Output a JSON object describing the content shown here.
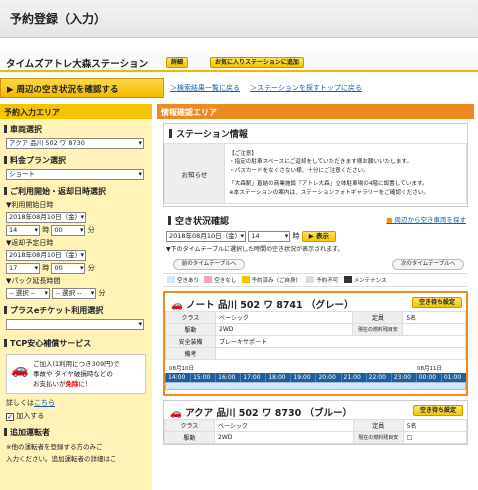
{
  "page_title": "予約登録（入力）",
  "station": {
    "name": "タイムズアトレ大森ステーション",
    "details_btn": "詳細",
    "favorite_btn": "お気に入りステーションに追加"
  },
  "nav": {
    "check_btn": "周辺の空き状況を確認する",
    "link_back_search": "＞検索結果一覧に戻る",
    "link_back_top": "＞ステーションを探すトップに戻る"
  },
  "left": {
    "header": "予約入力エリア",
    "vehicle_section": "車両選択",
    "vehicle_value": "アクア 品川 502 ワ 8730",
    "plan_section": "料金プラン選択",
    "plan_value": "ショート",
    "datetime_section": "ご利用開始・返却日時選択",
    "start_label": "▼利用開始日時",
    "start_date": "2018年08月10日（金）",
    "start_hour": "14",
    "start_min": "00",
    "hour_unit": "時",
    "min_unit": "分",
    "return_label": "▼返却予定日時",
    "return_date": "2018年08月10日（金）",
    "return_hour": "17",
    "return_min": "00",
    "pack_label": "▼パック延長時間",
    "pack_sel1": "-- 選択 --",
    "pack_sel2": "-- 選択 --",
    "pack_unit": "分",
    "ticket_section": "プラスeチケット利用選択",
    "ticket_value": "",
    "tcp_section": "TCP安心補償サービス",
    "tcp_notice_1": "ご加入(1利用につき309円)で",
    "tcp_notice_2": "事故や タイヤ破損時などの",
    "tcp_notice_3": "お支払いが",
    "tcp_notice_free": "免除",
    "tcp_notice_4": "に！",
    "detail_prefix": "詳しくは",
    "detail_link": "こちら",
    "join_label": "加入する",
    "driver_section": "追加運転者",
    "driver_note_1": "※他の運転者を登録する方のみご",
    "driver_note_2": "入力ください。追加運転者の詳細はこ"
  },
  "right": {
    "header": "情報確認エリア",
    "station_info_title": "ステーション情報",
    "notice_label": "お知らせ",
    "notice_lines": [
      "【ご注意】",
      "・指定の駐車スペースにご返却をしていただきます様お願いいたします。",
      "・パスカードをなくさない様、十分にご注意ください。",
      "",
      "「大森駅」直結の商業施設「アトレ大森」立体駐車場の4階に設置しています。",
      "※本ステーションの案内は、ステーションフォトギャラリーをご確認ください。"
    ],
    "availability_title": "空き状況確認",
    "availability_link": "周辺から空き車両を探す",
    "avail_date": "2018年08月10日（金）",
    "avail_hour": "14",
    "avail_hour_unit": "時",
    "display_btn": "表示",
    "avail_note": "▼下のタイムテーブルに選択した時間の空き状況が表示されます。",
    "prev_tt": "前のタイムテーブルへ",
    "next_tt": "次のタイムテーブルへ",
    "legend": [
      {
        "label": "空きあり",
        "color": "#d5e8f8"
      },
      {
        "label": "空きなし",
        "color": "#f5a5b5"
      },
      {
        "label": "予約済み（ご自身）",
        "color": "#f5c400"
      },
      {
        "label": "予約不可",
        "color": "#dddddd"
      },
      {
        "label": "メンテナンス",
        "color": "#333333"
      }
    ],
    "cars": [
      {
        "title": "ノート 品川 502 ワ 8741 （グレー）",
        "wait_btn": "空き待ち設定",
        "class_k": "クラス",
        "class_v": "ベーシック",
        "cap_k": "定員",
        "cap_v": "5名",
        "drive_k": "駆動",
        "drive_v": "2WD",
        "fuel_k": "現在の燃料残目安",
        "fuel_v": "",
        "safety_k": "安全装備",
        "safety_v": "ブレーキサポート",
        "note_k": "備考",
        "note_v": "",
        "date1": "08月10日",
        "date2": "08月11日",
        "hours": [
          "14:00",
          "15:00",
          "16:00",
          "17:00",
          "18:00",
          "19:00",
          "20:00",
          "21:00",
          "22:00",
          "23:00",
          "00:00",
          "01:00"
        ]
      },
      {
        "title": "アクア 品川 502 ワ 8730 （ブルー）",
        "wait_btn": "空き待ち設定",
        "class_k": "クラス",
        "class_v": "ベーシック",
        "cap_k": "定員",
        "cap_v": "5名",
        "drive_k": "駆動",
        "drive_v": "2WD",
        "fuel_k": "現在の燃料残目安",
        "fuel_v": "□"
      }
    ]
  }
}
